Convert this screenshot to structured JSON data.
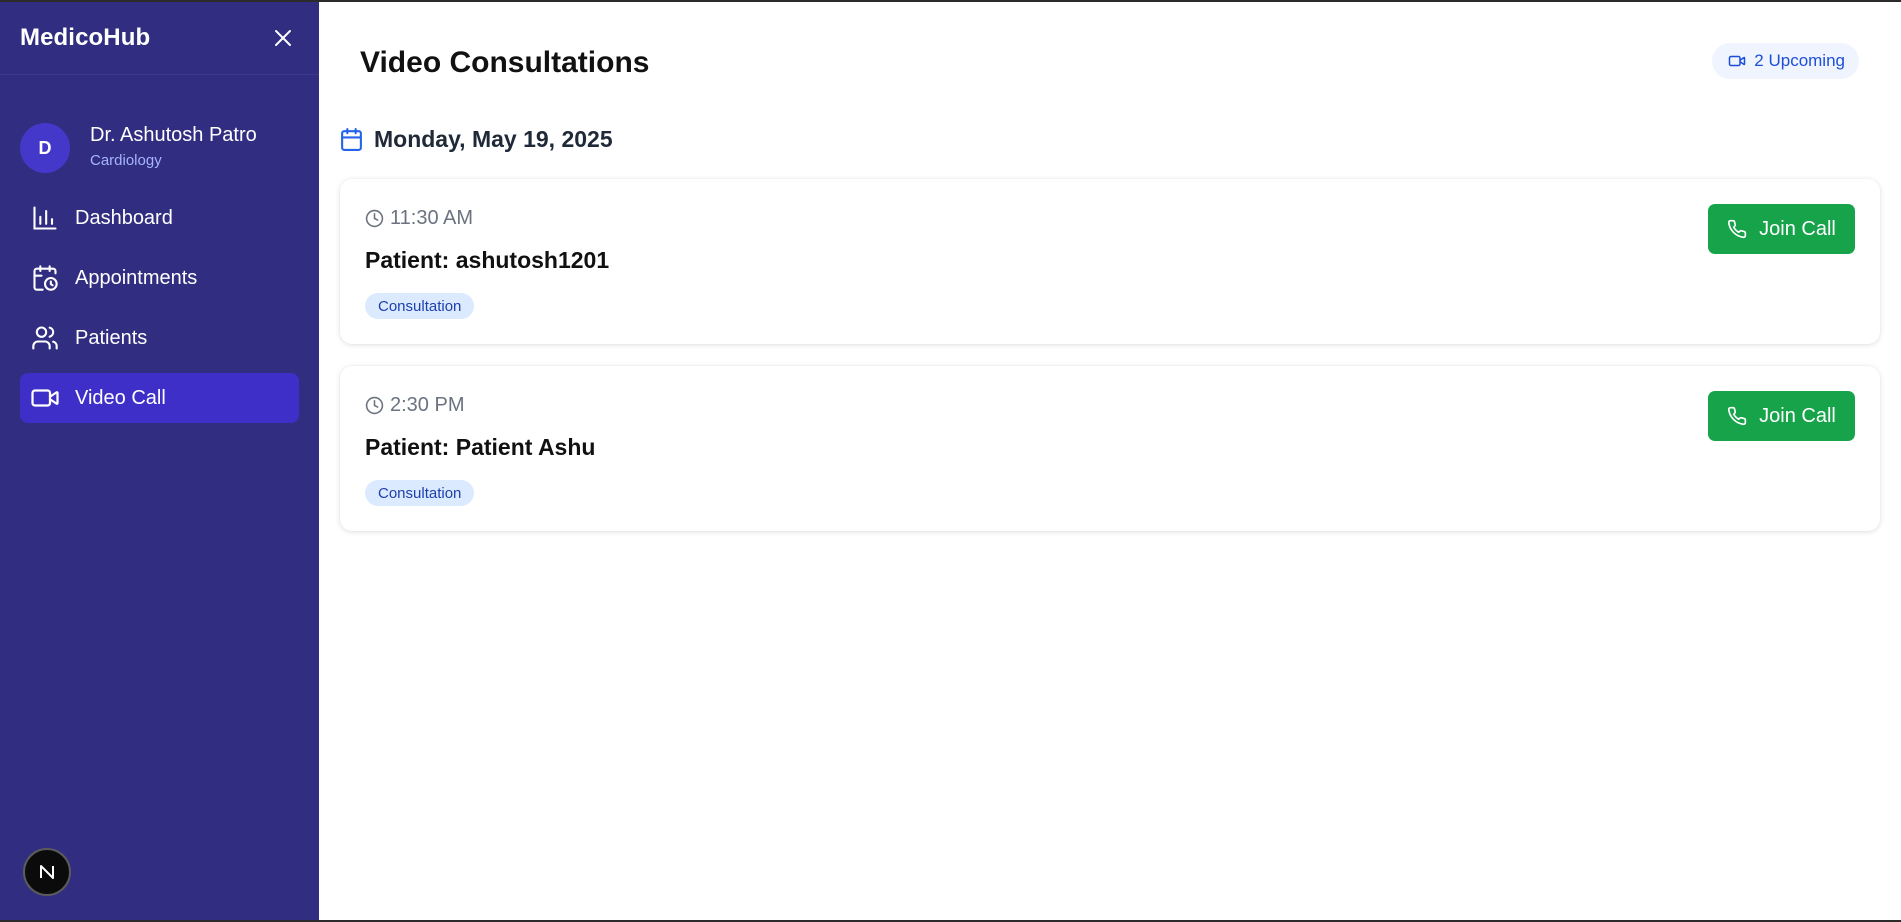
{
  "sidebar": {
    "brand": "MedicoHub",
    "profile": {
      "avatar_initial": "D",
      "name": "Dr. Ashutosh Patro",
      "specialty": "Cardiology"
    },
    "items": [
      {
        "label": "Dashboard",
        "icon": "bar-chart-icon"
      },
      {
        "label": "Appointments",
        "icon": "calendar-clock-icon"
      },
      {
        "label": "Patients",
        "icon": "users-icon"
      },
      {
        "label": "Video Call",
        "icon": "video-icon",
        "active": true
      }
    ],
    "footer_badge": "N"
  },
  "main": {
    "title": "Video Consultations",
    "upcoming_badge": "2 Upcoming",
    "date": "Monday, May 19, 2025",
    "consultations": [
      {
        "time": "11:30 AM",
        "patient": "Patient: ashutosh1201",
        "tag": "Consultation",
        "action": "Join Call"
      },
      {
        "time": "2:30 PM",
        "patient": "Patient: Patient Ashu",
        "tag": "Consultation",
        "action": "Join Call"
      }
    ]
  },
  "colors": {
    "sidebar_bg": "#312e81",
    "active_item": "#3f2fc9",
    "join_button": "#16a34a",
    "tag_bg": "#dbeafe",
    "accent_blue": "#1d4ed8"
  }
}
